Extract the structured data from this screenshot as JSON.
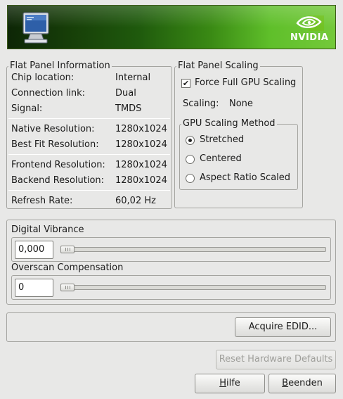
{
  "banner": {
    "logo_text": "NVIDIA",
    "icon": "monitor-icon",
    "logo_icon": "nvidia-eye-icon"
  },
  "flat_panel_info": {
    "title": "Flat Panel Information",
    "rows": [
      {
        "label": "Chip location:",
        "value": "Internal"
      },
      {
        "label": "Connection link:",
        "value": "Dual"
      },
      {
        "label": "Signal:",
        "value": "TMDS"
      },
      {
        "label": "Native Resolution:",
        "value": "1280x1024"
      },
      {
        "label": "Best Fit Resolution:",
        "value": "1280x1024"
      },
      {
        "label": "Frontend Resolution:",
        "value": "1280x1024"
      },
      {
        "label": "Backend Resolution:",
        "value": "1280x1024"
      },
      {
        "label": "Refresh Rate:",
        "value": "60,02 Hz"
      }
    ]
  },
  "flat_panel_scaling": {
    "title": "Flat Panel Scaling",
    "force_gpu_label": "Force Full GPU Scaling",
    "force_gpu_checked": true,
    "scaling_label": "Scaling:",
    "scaling_value": "None",
    "method_title": "GPU Scaling Method",
    "methods": [
      {
        "label": "Stretched",
        "selected": true
      },
      {
        "label": "Centered",
        "selected": false
      },
      {
        "label": "Aspect Ratio Scaled",
        "selected": false
      }
    ]
  },
  "digital_vibrance": {
    "label": "Digital Vibrance",
    "value": "0,000",
    "level": 0
  },
  "overscan": {
    "label": "Overscan Compensation",
    "value": "0",
    "level": 0
  },
  "buttons": {
    "acquire_edid": "Acquire EDID...",
    "reset_defaults": "Reset Hardware Defaults",
    "help_mnemonic": "H",
    "help_rest": "ilfe",
    "quit_mnemonic": "B",
    "quit_rest": "eenden"
  },
  "colors": {
    "nvidia_green": "#76b900",
    "banner_dark": "#0d2606"
  }
}
